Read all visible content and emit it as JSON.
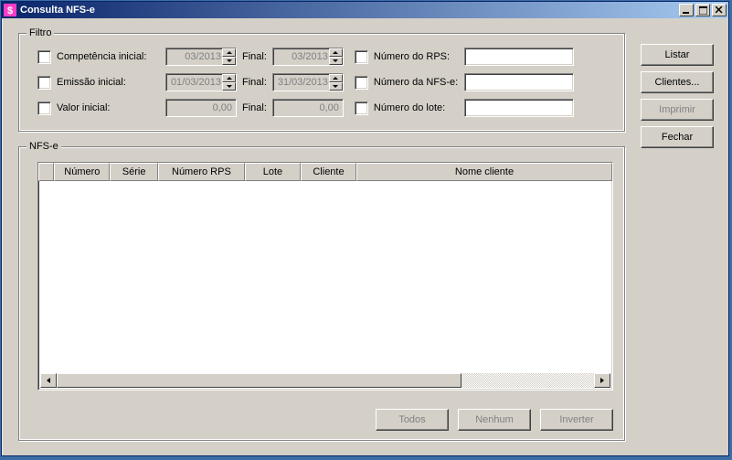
{
  "window": {
    "title": "Consulta NFS-e"
  },
  "filtro": {
    "legend": "Filtro",
    "competencia_chk": "Competência inicial:",
    "competencia_ini": "03/2013",
    "competencia_final_label": "Final:",
    "competencia_fin": "03/2013",
    "emissao_chk": "Emissão inicial:",
    "emissao_ini": "01/03/2013",
    "emissao_final_label": "Final:",
    "emissao_fin": "31/03/2013",
    "valor_chk": "Valor inicial:",
    "valor_ini": "0,00",
    "valor_final_label": "Final:",
    "valor_fin": "0,00",
    "numero_rps_chk": "Número do RPS:",
    "numero_rps_val": "",
    "numero_nfse_chk": "Número da NFS-e:",
    "numero_nfse_val": "",
    "numero_lote_chk": "Número do lote:",
    "numero_lote_val": ""
  },
  "nfse": {
    "legend": "NFS-e",
    "cols": {
      "numero": "Número",
      "serie": "Série",
      "numero_rps": "Número RPS",
      "lote": "Lote",
      "cliente": "Cliente",
      "nome_cliente": "Nome cliente"
    }
  },
  "buttons": {
    "listar": "Listar",
    "clientes": "Clientes...",
    "imprimir": "Imprimir",
    "fechar": "Fechar",
    "todos": "Todos",
    "nenhum": "Nenhum",
    "inverter": "Inverter"
  }
}
